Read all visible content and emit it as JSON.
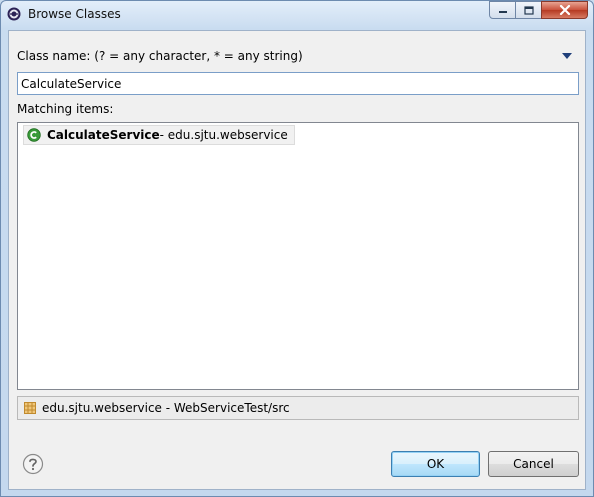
{
  "window": {
    "title": "Browse Classes",
    "icon": "eclipse-app-icon"
  },
  "controls": {
    "minimize_icon": "minimize-icon",
    "maximize_icon": "maximize-icon",
    "close_icon": "close-icon"
  },
  "search": {
    "label": "Class name: (? = any character, * = any string)",
    "value": "CalculateService",
    "menu_icon": "dropdown-triangle-icon"
  },
  "results": {
    "label": "Matching items:",
    "items": [
      {
        "name": "CalculateService",
        "detail": " - edu.sjtu.webservice",
        "icon": "java-class-icon"
      }
    ]
  },
  "status": {
    "text": "edu.sjtu.webservice - WebServiceTest/src",
    "icon": "package-icon"
  },
  "buttons": {
    "help_icon": "help-icon",
    "ok": "OK",
    "cancel": "Cancel"
  },
  "colors": {
    "class_icon": "#3a9b3a",
    "package_icon": "#c08a2e",
    "close_button": "#c9503a"
  }
}
